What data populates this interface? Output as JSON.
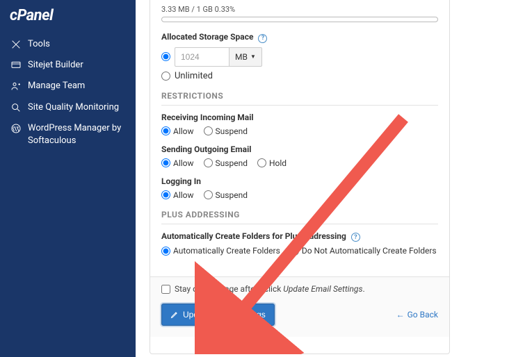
{
  "brand": "cPanel",
  "sidebar": {
    "items": [
      {
        "label": "Tools"
      },
      {
        "label": "Sitejet Builder"
      },
      {
        "label": "Manage Team"
      },
      {
        "label": "Site Quality Monitoring"
      },
      {
        "label": "WordPress Manager by Softaculous"
      }
    ]
  },
  "storage": {
    "usage_text": "3.33 MB / 1 GB 0.33%",
    "label": "Allocated Storage Space",
    "value": "1024",
    "unit": "MB",
    "unlimited_label": "Unlimited"
  },
  "restrictions": {
    "title": "RESTRICTIONS",
    "incoming": {
      "label": "Receiving Incoming Mail",
      "allow": "Allow",
      "suspend": "Suspend"
    },
    "outgoing": {
      "label": "Sending Outgoing Email",
      "allow": "Allow",
      "suspend": "Suspend",
      "hold": "Hold"
    },
    "logging": {
      "label": "Logging In",
      "allow": "Allow",
      "suspend": "Suspend"
    }
  },
  "plus": {
    "title": "PLUS ADDRESSING",
    "label": "Automatically Create Folders for Plus Addressing",
    "opt1": "Automatically Create Folders",
    "opt2": "Do Not Automatically Create Folders"
  },
  "footer": {
    "stay_prefix": "Stay on this page after I click ",
    "stay_em": "Update Email Settings",
    "stay_suffix": ".",
    "update_btn": "Update Email Settings",
    "go_back": "Go Back"
  }
}
